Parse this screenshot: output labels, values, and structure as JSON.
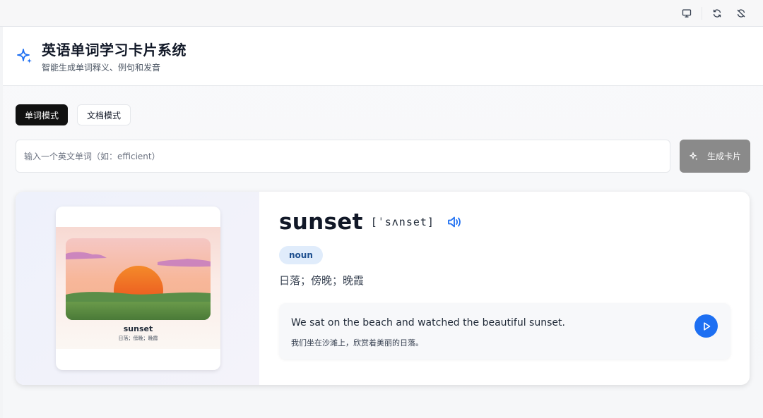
{
  "header": {
    "title": "英语单词学习卡片系统",
    "subtitle": "智能生成单词释义、例句和发音"
  },
  "tabs": [
    {
      "label": "单词模式",
      "active": true
    },
    {
      "label": "文档模式",
      "active": false
    }
  ],
  "search": {
    "placeholder": "输入一个英文单词（如：efficient）",
    "value": ""
  },
  "generate_button": {
    "label": "生成卡片"
  },
  "card": {
    "word": "sunset",
    "phonetic": "[ˈsʌnset]",
    "part_of_speech": "noun",
    "meaning": "日落；傍晚；晚霞",
    "thumbnail": {
      "word": "sunset",
      "meaning": "日落；傍晚；晚霞"
    },
    "example": {
      "en": "We sat on the beach and watched the beautiful sunset.",
      "zh": "我们坐在沙滩上，欣赏着美丽的日落。"
    }
  },
  "colors": {
    "accent": "#1d6ff2",
    "badge_bg": "#e0ecfb",
    "badge_text": "#1e4f8f",
    "tab_active_bg": "#111111",
    "generate_button_bg": "#8a8a8a"
  },
  "icons": {
    "window": [
      "monitor-icon",
      "refresh-icon",
      "sync-off-icon"
    ],
    "logo": "sparkles-icon",
    "generate": "sparkles-icon",
    "pronounce": "speaker-icon",
    "play": "play-icon"
  }
}
